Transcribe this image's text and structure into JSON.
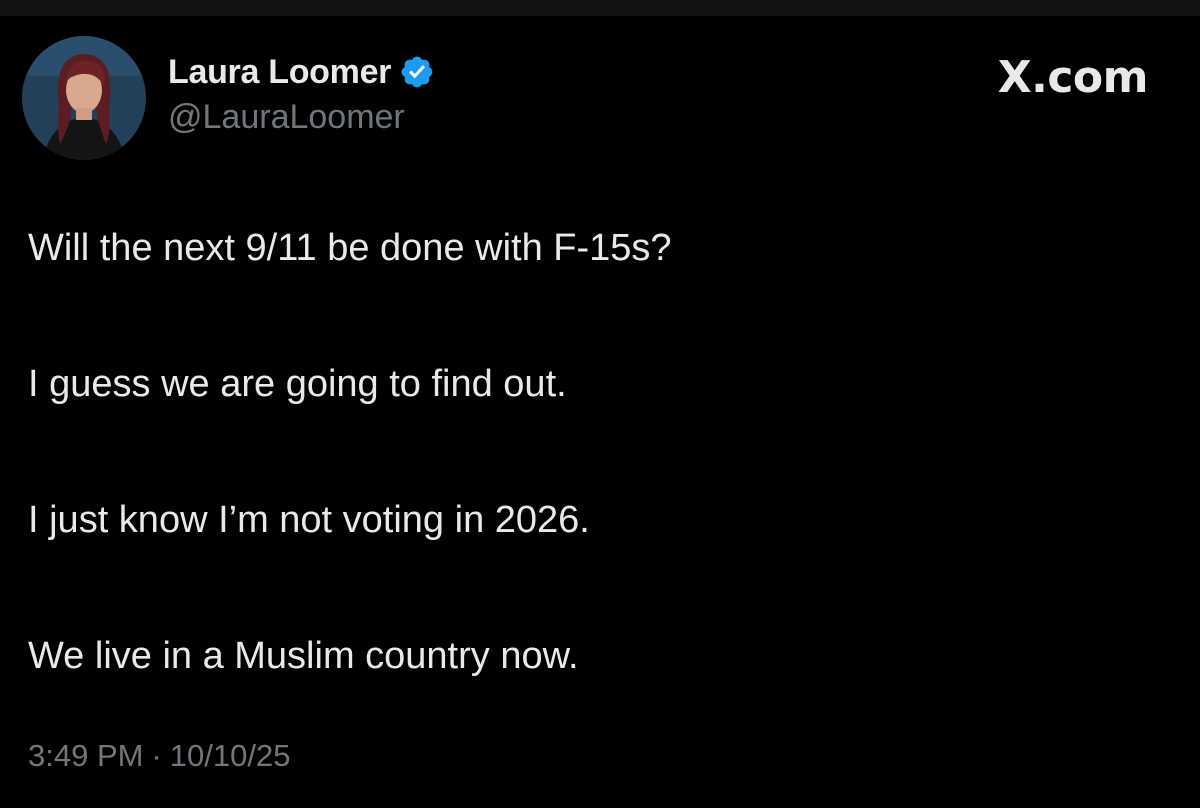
{
  "author": {
    "display_name": "Laura Loomer",
    "handle": "@LauraLoomer",
    "verified_badge_color": "#1d9bf0"
  },
  "brand": {
    "label": "X.com"
  },
  "tweet": {
    "paragraphs": [
      "Will the next 9/11 be done with F-15s?",
      "I guess we are going to find out.",
      "I just know I’m not voting in 2026.",
      "We live in a Muslim country now."
    ],
    "time": "3:49 PM",
    "separator": "·",
    "date": "10/10/25"
  },
  "icons": {
    "avatar": "profile-photo",
    "verified": "verified-badge-icon"
  },
  "colors": {
    "background": "#000000",
    "primary_text": "#e7e9ea",
    "secondary_text": "#71767b"
  }
}
